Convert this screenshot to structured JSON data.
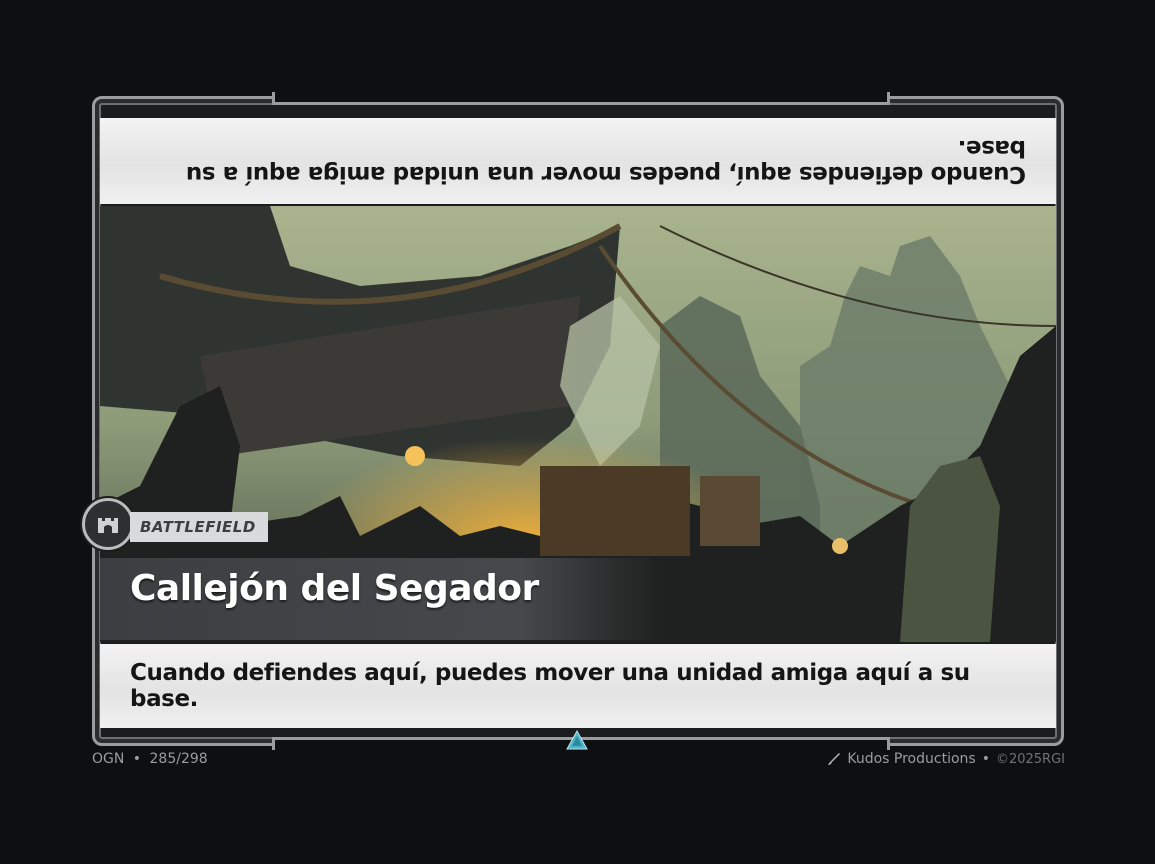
{
  "card": {
    "rules_text_top_inverted": "Cuando defiendes aquí, puedes mover una unidad amiga aquí a su base.",
    "type_label": "BATTLEFIELD",
    "type_icon": "battlefield-tower-icon",
    "name": "Callejón del Segador",
    "rules_text": "Cuando defiendes aquí, puedes mover una unidad amiga aquí a su base.",
    "rarity_icon": "triangle-rarity-icon",
    "rarity_color": "#4fb3c9"
  },
  "footer": {
    "set_code": "OGN",
    "separator": "•",
    "collector_number": "285/298",
    "artist_icon": "paintbrush-icon",
    "artist": "Kudos Productions",
    "artist_separator": "•",
    "copyright": "©2025RGI"
  }
}
